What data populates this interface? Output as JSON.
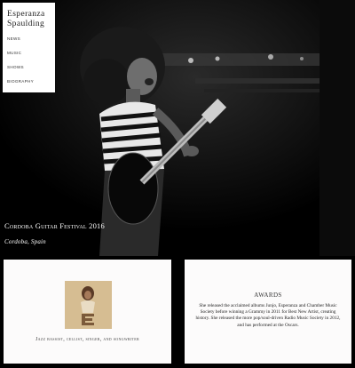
{
  "site": {
    "brand_line1": "Esperanza",
    "brand_line2": "Spaulding"
  },
  "nav": {
    "items": [
      {
        "label": "News"
      },
      {
        "label": "Music"
      },
      {
        "label": "Shows"
      },
      {
        "label": "Biography"
      }
    ]
  },
  "hero": {
    "event_title": "Cordoba Guitar Festival 2016",
    "event_location": "Cordoba, Spain"
  },
  "cards": {
    "intro": {
      "tagline": "Jazz bassist, cellist, singer, and songwriter"
    },
    "awards": {
      "title": "Awards",
      "text": "She released the acclaimed albums Junjo, Esperanza and Chamber Music Society before winning a Grammy in 2011 for Best New Artist, creating history. She released the more pop/soul-driven Radio Music Society in 2012, and has performed at the Oscars."
    }
  },
  "colors": {
    "page_background": "#000000",
    "card_background": "#fcfbfb",
    "album_background": "#d6bd92"
  },
  "icons": [
    "performer-photo",
    "album-cover"
  ]
}
